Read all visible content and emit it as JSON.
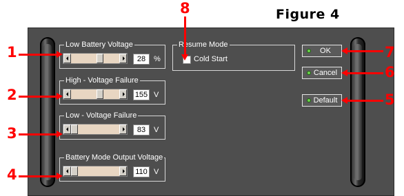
{
  "figure_title": "Figure 4",
  "groups": [
    {
      "title": "Low Battery Voltage",
      "value": "28",
      "unit": "%"
    },
    {
      "title": "High - Voltage Failure",
      "value": "155",
      "unit": "V"
    },
    {
      "title": "Low - Voltage Failure",
      "value": "83",
      "unit": "V"
    },
    {
      "title": "Battery Mode Output Voltage",
      "value": "110",
      "unit": "V"
    }
  ],
  "resume_mode": {
    "title": "Resume Mode",
    "checkbox_label": "Cold Start"
  },
  "buttons": {
    "ok": "OK",
    "cancel": "Cancel",
    "default": "Default"
  },
  "callouts": {
    "c1": "1",
    "c2": "2",
    "c3": "3",
    "c4": "4",
    "c5": "5",
    "c6": "6",
    "c7": "7",
    "c8": "8"
  },
  "colors": {
    "callout": "#ff0000",
    "panel": "#4e4e4e",
    "slider_track": "#e8d6c2",
    "led": "#6bd34a"
  }
}
